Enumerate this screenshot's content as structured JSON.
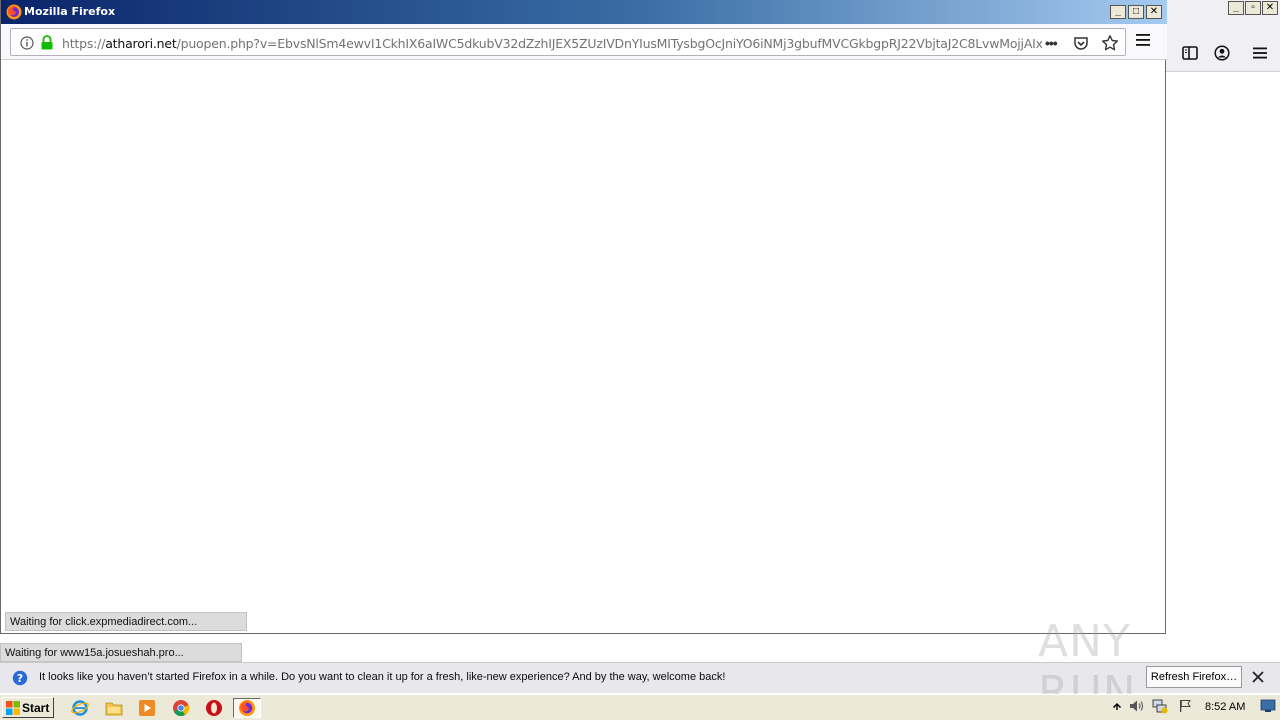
{
  "popup_window": {
    "title": "Mozilla Firefox",
    "url_prefix": "https://",
    "url_host": "atharori.net",
    "url_rest": "/puopen.php?v=EbvsNlSm4ewvI1CkhIX6aIWC5dkubV32dZzhIJEX5ZUzIVDnYIusMITysbgOcJniYO6iNMj3gbufMVCGkbgpRJ22VbjtaJ2C8LvwMojjAIxlMxDWAa",
    "status_text": "Waiting for click.expmediadirect.com..."
  },
  "background_window": {
    "status_text": "Waiting for www15a.josueshah.pro..."
  },
  "notification": {
    "message": "It looks like you haven’t started Firefox in a while. Do you want to clean it up for a fresh, like-new experience? And by the way, welcome back!",
    "button_label": "Refresh Firefox…"
  },
  "taskbar": {
    "start_label": "Start",
    "clock": "8:52 AM"
  },
  "watermark": {
    "text": "ANY RUN"
  },
  "colors": {
    "titlebar_start": "#0a246a",
    "titlebar_end": "#a6caf0",
    "lock_green": "#12bc00",
    "taskbar_bg": "#ece9d8"
  }
}
